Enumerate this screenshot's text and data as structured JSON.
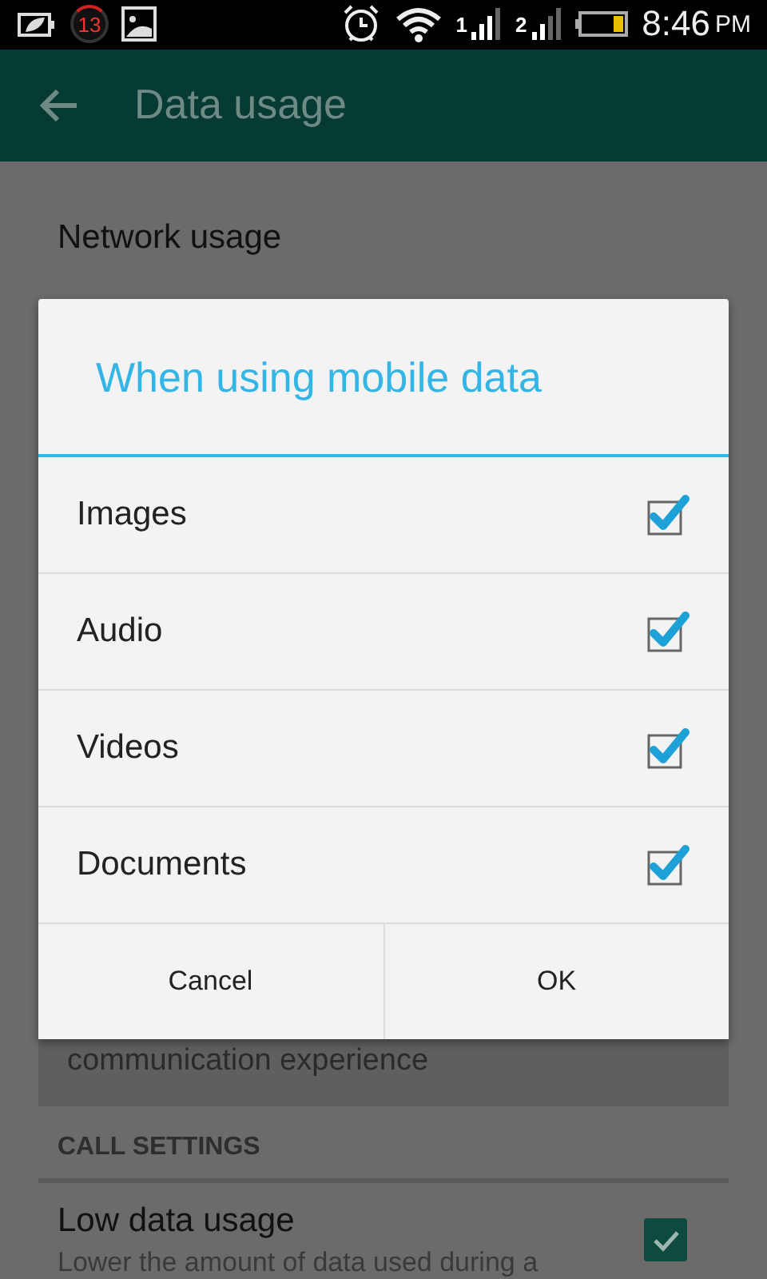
{
  "status_bar": {
    "notification_count": "13",
    "sim_1": "1",
    "sim_2": "2",
    "time": "8:46",
    "meridiem": "PM"
  },
  "app_bar": {
    "title": "Data usage"
  },
  "background": {
    "network_usage": "Network usage",
    "card_text": "communication experience",
    "section_header": "CALL SETTINGS",
    "setting": {
      "title": "Low data usage",
      "summary": "Lower the amount of data used during a",
      "checked": true
    }
  },
  "dialog": {
    "title": "When using mobile data",
    "options": [
      {
        "label": "Images",
        "checked": true
      },
      {
        "label": "Audio",
        "checked": true
      },
      {
        "label": "Videos",
        "checked": true
      },
      {
        "label": "Documents",
        "checked": true
      }
    ],
    "buttons": [
      "Cancel",
      "OK"
    ]
  }
}
